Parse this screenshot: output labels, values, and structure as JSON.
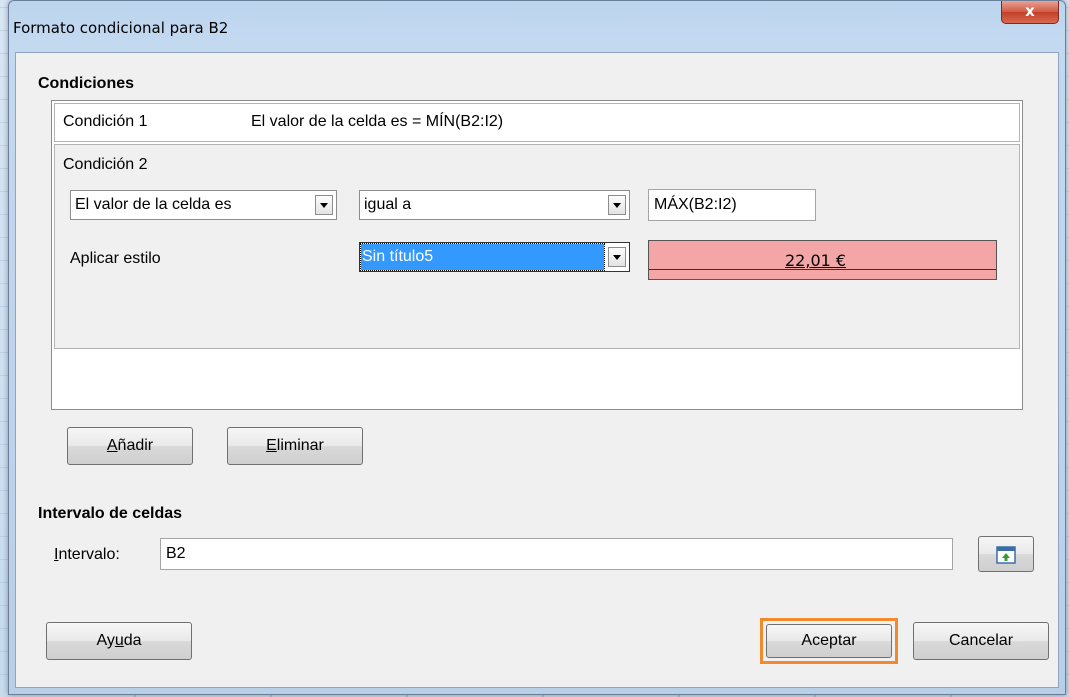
{
  "dialog": {
    "title": "Formato condicional para B2",
    "close_label": "x"
  },
  "conditions": {
    "section_title": "Condiciones",
    "condition1": {
      "label": "Condición 1",
      "summary": "El valor de la celda es = MÍN(B2:I2)"
    },
    "condition2": {
      "label": "Condición 2",
      "type_select": "El valor de la celda es",
      "operator_select": "igual a",
      "value_field": "MÁX(B2:I2)",
      "apply_style_label": "Aplicar estilo",
      "style_select": "Sin título5",
      "preview_text": "22,01 €",
      "preview_color": "#f4a6a6",
      "selected_color": "#3399ff"
    },
    "add_button": {
      "pre": "",
      "accel": "A",
      "post": "ñadir"
    },
    "remove_button": {
      "pre": "",
      "accel": "E",
      "post": "liminar"
    }
  },
  "range": {
    "section_title": "Intervalo de celdas",
    "label_accel": "I",
    "label_rest": "ntervalo:",
    "value": "B2",
    "shrink_icon": "shrink-range-icon"
  },
  "footer": {
    "help_button": {
      "pre": "Ay",
      "accel": "u",
      "post": "da"
    },
    "ok_button": "Aceptar",
    "cancel_button": "Cancelar",
    "highlight_color": "#f08a2c"
  }
}
